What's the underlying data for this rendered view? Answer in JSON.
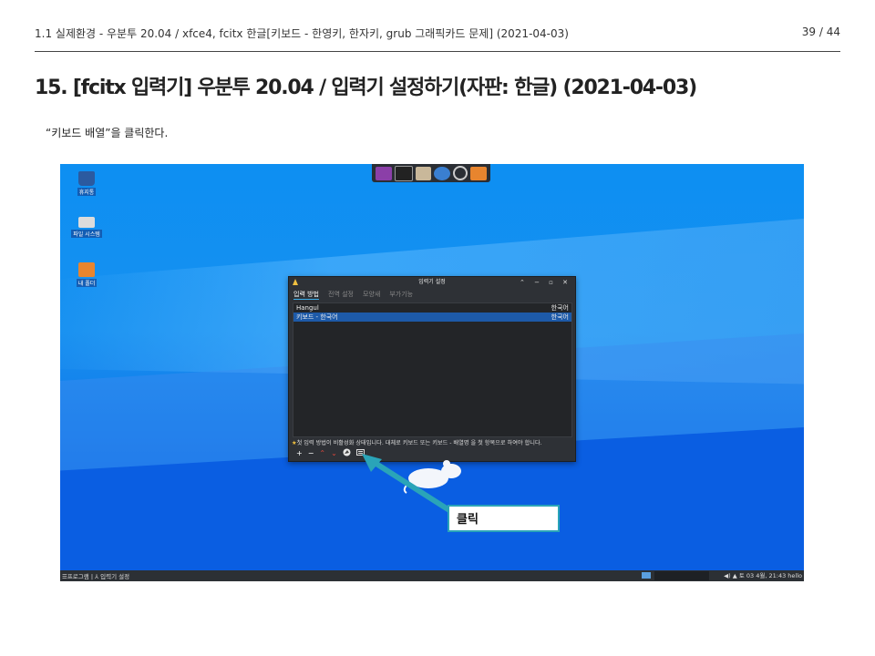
{
  "header": {
    "breadcrumb": "1.1 실제환경 - 우분투 20.04 / xfce4, fcitx 한글[키보드 - 한영키, 한자키, grub 그래픽카드 문제] (2021-04-03)",
    "page_number": "39 / 44"
  },
  "title": "15. [fcitx 입력기] 우분투 20.04 / 입력기 설정하기(자판: 한글) (2021-04-03)",
  "instruction": "“키보드 배열”을 클릭한다.",
  "desktop": {
    "icons": [
      {
        "label": "휴지통",
        "icon": "trash-icon"
      },
      {
        "label": "파일 시스템",
        "icon": "drive-icon"
      },
      {
        "label": "내 폴더",
        "icon": "home-folder-icon"
      }
    ],
    "dock_icons": [
      "app-menu-icon",
      "terminal-icon",
      "file-manager-icon",
      "web-browser-icon",
      "search-icon",
      "folder-icon"
    ]
  },
  "window": {
    "title": "입력기 설정",
    "tabs": [
      "입력 방법",
      "전역 설정",
      "모양새",
      "부가기능"
    ],
    "list_rows": [
      {
        "name": "Hangul",
        "lang": "한국어"
      },
      {
        "name": "키보드 - 한국어",
        "lang": "한국어"
      }
    ],
    "warning": "첫 입력 방법이 비활성화 상태입니다. 대체로 키보드 또는 키보드 - 배열명 을 첫 항목으로 하여야 합니다.",
    "buttons": [
      "+",
      "−",
      "⌃",
      "⌄",
      "keyboard-layout-icon",
      "keyboard-icon"
    ]
  },
  "callout": "클릭",
  "taskbar": {
    "left": "☰프로그램 | ⅄  입력기 설정",
    "clock": "토 03  4월, 21:43  hello"
  },
  "colors": {
    "accent": "#3daee9",
    "selection": "#1d5aa8",
    "callout_border": "#2aa4b8"
  }
}
